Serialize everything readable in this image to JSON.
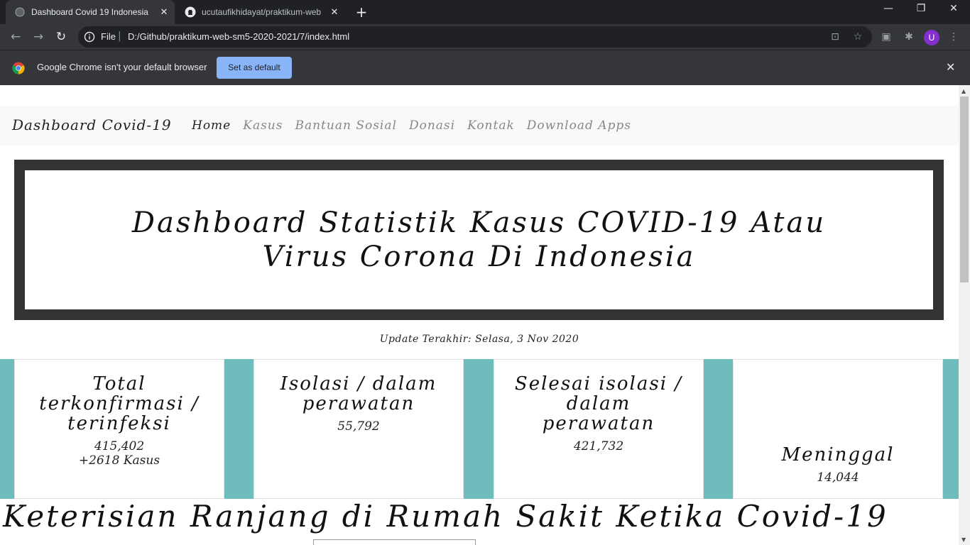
{
  "browser": {
    "tabs": [
      {
        "title": "Dashboard Covid 19 Indonesia",
        "active": true
      },
      {
        "title": "ucutaufikhidayat/praktikum-web",
        "active": false
      }
    ],
    "address": {
      "scheme": "File",
      "url": "D:/Github/praktikum-web-sm5-2020-2021/7/index.html"
    },
    "profile_initial": "U",
    "infobar": {
      "message": "Google Chrome isn't your default browser",
      "button": "Set as default"
    }
  },
  "site": {
    "brand": "Dashboard Covid-19",
    "nav": [
      "Home",
      "Kasus",
      "Bantuan Sosial",
      "Donasi",
      "Kontak",
      "Download Apps"
    ],
    "hero_title": "Dashboard Statistik Kasus COVID-19 Atau Virus Corona Di Indonesia",
    "update_text": "Update Terakhir: Selasa, 3 Nov 2020",
    "cards": [
      {
        "title": "Total terkonfirmasi / terinfeksi",
        "value": "415,402",
        "extra": "+2618 Kasus"
      },
      {
        "title": "Isolasi / dalam perawatan",
        "value": "55,792"
      },
      {
        "title": "Selesai isolasi / dalam perawatan",
        "value": "421,732"
      },
      {
        "title": "Meninggal",
        "value": "14,044"
      }
    ],
    "section_heading": "Keterisian Ranjang di Rumah Sakit Ketika Covid-19"
  }
}
